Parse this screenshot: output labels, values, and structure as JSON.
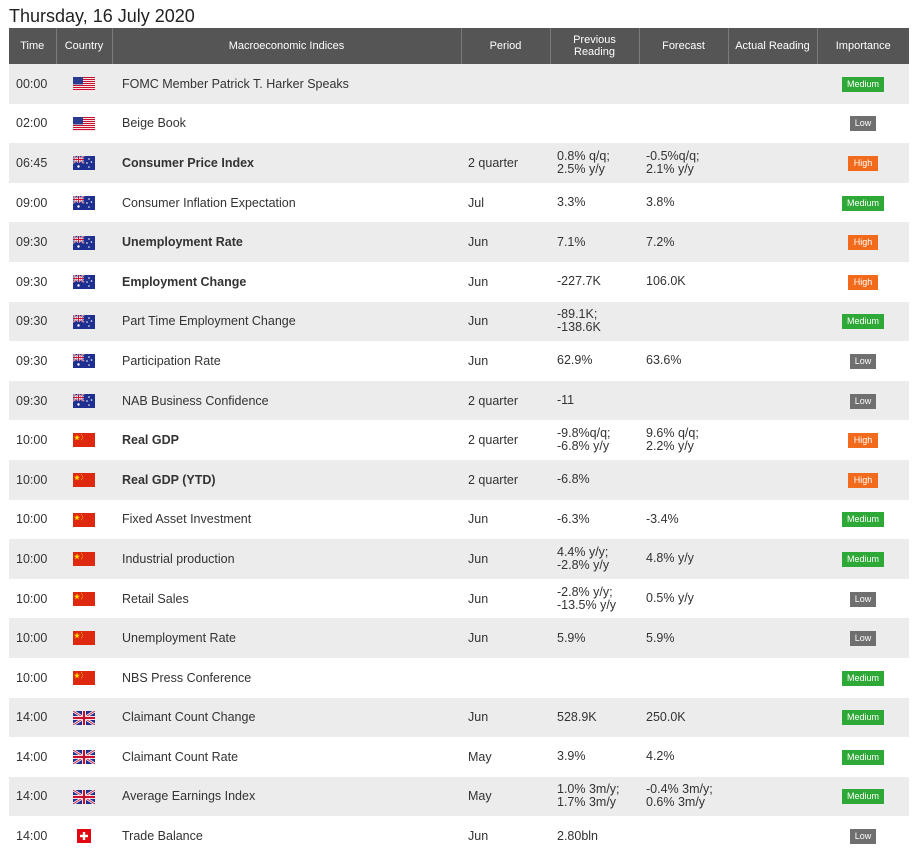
{
  "date_title": "Thursday, 16 July 2020",
  "headers": {
    "time": "Time",
    "country": "Country",
    "indices": "Macroeconomic Indices",
    "period": "Period",
    "previous_line1": "Previous",
    "previous_line2": "Reading",
    "forecast": "Forecast",
    "actual": "Actual Reading",
    "importance": "Importance"
  },
  "rows": [
    {
      "time": "00:00",
      "flag": "us-flag-icon",
      "event": "FOMC Member Patrick T. Harker Speaks",
      "bold": false,
      "period": "",
      "prev1": "",
      "prev2": "",
      "fc1": "",
      "fc2": "",
      "actual": "",
      "importance": "Medium"
    },
    {
      "time": "02:00",
      "flag": "us-flag-icon",
      "event": "Beige Book",
      "bold": false,
      "period": "",
      "prev1": "",
      "prev2": "",
      "fc1": "",
      "fc2": "",
      "actual": "",
      "importance": "Low"
    },
    {
      "time": "06:45",
      "flag": "au-flag-icon",
      "event": "Consumer Price Index",
      "bold": true,
      "period": "2 quarter",
      "prev1": "0.8% q/q;",
      "prev2": "2.5% y/y",
      "fc1": "-0.5%q/q;",
      "fc2": "2.1% y/y",
      "actual": "",
      "importance": "High"
    },
    {
      "time": "09:00",
      "flag": "au-flag-icon",
      "event": "Consumer Inflation Expectation",
      "bold": false,
      "period": "Jul",
      "prev1": "3.3%",
      "prev2": "",
      "fc1": "3.8%",
      "fc2": "",
      "actual": "",
      "importance": "Medium"
    },
    {
      "time": "09:30",
      "flag": "au-flag-icon",
      "event": "Unemployment Rate",
      "bold": true,
      "period": "Jun",
      "prev1": "7.1%",
      "prev2": "",
      "fc1": "7.2%",
      "fc2": "",
      "actual": "",
      "importance": "High"
    },
    {
      "time": "09:30",
      "flag": "au-flag-icon",
      "event": "Employment Change",
      "bold": true,
      "period": "Jun",
      "prev1": "-227.7K",
      "prev2": "",
      "fc1": "106.0K",
      "fc2": "",
      "actual": "",
      "importance": "High"
    },
    {
      "time": "09:30",
      "flag": "au-flag-icon",
      "event": "Part Time Employment Change",
      "bold": false,
      "period": "Jun",
      "prev1": "-89.1K;",
      "prev2": "-138.6K",
      "fc1": "",
      "fc2": "",
      "actual": "",
      "importance": "Medium"
    },
    {
      "time": "09:30",
      "flag": "au-flag-icon",
      "event": "Participation Rate",
      "bold": false,
      "period": "Jun",
      "prev1": "62.9%",
      "prev2": "",
      "fc1": "63.6%",
      "fc2": "",
      "actual": "",
      "importance": "Low"
    },
    {
      "time": "09:30",
      "flag": "au-flag-icon",
      "event": "NAB Business Confidence",
      "bold": false,
      "period": "2 quarter",
      "prev1": "-11",
      "prev2": "",
      "fc1": "",
      "fc2": "",
      "actual": "",
      "importance": "Low"
    },
    {
      "time": "10:00",
      "flag": "cn-flag-icon",
      "event": "Real GDP",
      "bold": true,
      "period": "2 quarter",
      "prev1": "-9.8%q/q;",
      "prev2": "-6.8% y/y",
      "fc1": "9.6% q/q;",
      "fc2": "2.2% y/y",
      "actual": "",
      "importance": "High"
    },
    {
      "time": "10:00",
      "flag": "cn-flag-icon",
      "event": "Real GDP (YTD)",
      "bold": true,
      "period": "2 quarter",
      "prev1": "-6.8%",
      "prev2": "",
      "fc1": "",
      "fc2": "",
      "actual": "",
      "importance": "High"
    },
    {
      "time": "10:00",
      "flag": "cn-flag-icon",
      "event": "Fixed Asset Investment",
      "bold": false,
      "period": "Jun",
      "prev1": "-6.3%",
      "prev2": "",
      "fc1": "-3.4%",
      "fc2": "",
      "actual": "",
      "importance": "Medium"
    },
    {
      "time": "10:00",
      "flag": "cn-flag-icon",
      "event": "Industrial production",
      "bold": false,
      "period": "Jun",
      "prev1": "4.4% y/y;",
      "prev2": "-2.8% y/y",
      "fc1": "4.8% y/y",
      "fc2": "",
      "actual": "",
      "importance": "Medium"
    },
    {
      "time": "10:00",
      "flag": "cn-flag-icon",
      "event": "Retail Sales",
      "bold": false,
      "period": "Jun",
      "prev1": "-2.8% y/y;",
      "prev2": "-13.5% y/y",
      "fc1": "0.5% y/y",
      "fc2": "",
      "actual": "",
      "importance": "Low"
    },
    {
      "time": "10:00",
      "flag": "cn-flag-icon",
      "event": "Unemployment Rate",
      "bold": false,
      "period": "Jun",
      "prev1": "5.9%",
      "prev2": "",
      "fc1": "5.9%",
      "fc2": "",
      "actual": "",
      "importance": "Low"
    },
    {
      "time": "10:00",
      "flag": "cn-flag-icon",
      "event": "NBS Press Conference",
      "bold": false,
      "period": "",
      "prev1": "",
      "prev2": "",
      "fc1": "",
      "fc2": "",
      "actual": "",
      "importance": "Medium"
    },
    {
      "time": "14:00",
      "flag": "uk-flag-icon",
      "event": "Claimant Count Change",
      "bold": false,
      "period": "Jun",
      "prev1": "528.9K",
      "prev2": "",
      "fc1": "250.0K",
      "fc2": "",
      "actual": "",
      "importance": "Medium"
    },
    {
      "time": "14:00",
      "flag": "uk-flag-icon",
      "event": "Claimant Count Rate",
      "bold": false,
      "period": "May",
      "prev1": "3.9%",
      "prev2": "",
      "fc1": "4.2%",
      "fc2": "",
      "actual": "",
      "importance": "Medium"
    },
    {
      "time": "14:00",
      "flag": "uk-flag-icon",
      "event": "Average Earnings Index",
      "bold": false,
      "period": "May",
      "prev1": "1.0% 3m/y;",
      "prev2": "1.7% 3m/y",
      "fc1": "-0.4% 3m/y;",
      "fc2": "0.6% 3m/y",
      "actual": "",
      "importance": "Medium"
    },
    {
      "time": "14:00",
      "flag": "ch-flag-icon",
      "event": "Trade Balance",
      "bold": false,
      "period": "Jun",
      "prev1": "2.80bln",
      "prev2": "",
      "fc1": "",
      "fc2": "",
      "actual": "",
      "importance": "Low"
    }
  ],
  "colors": {
    "header_bg": "#555555",
    "row_alt": "#ececec",
    "medium": "#2ea836",
    "low": "#6f6f6f",
    "high": "#f26b1d"
  }
}
